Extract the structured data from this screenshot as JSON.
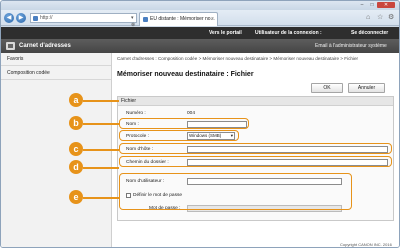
{
  "browser": {
    "window_controls": {
      "minimize": "–",
      "maximize": "□",
      "close": "✕"
    },
    "nav": {
      "back": "◀",
      "forward": "▶"
    },
    "url": "http://",
    "address_tools": "▾ ⊗ ⟳ ✕",
    "tab": {
      "title": "EU distante : Mémoriser no...",
      "close": "×"
    },
    "toolbar_icons": {
      "home": "⌂",
      "favorites": "☆",
      "settings": "⚙"
    }
  },
  "topbar": {
    "portal_link": "Vers le portail",
    "user_label": "Utilisateur de la connexion :",
    "user_name": "",
    "logout_link": "Se déconnecter"
  },
  "header": {
    "title": "Carnet d'adresses",
    "admin_mail": "Email à l'administrateur système"
  },
  "sidebar": {
    "items": [
      {
        "label": "Favoris"
      },
      {
        "label": "Composition codée"
      }
    ]
  },
  "main": {
    "breadcrumb": "Carnet d'adresses : Composition codée > Mémoriser nouveau destinataire > Mémoriser nouveau destinataire > Fichier",
    "title": "Mémoriser nouveau destinataire : Fichier",
    "ok_label": "OK",
    "cancel_label": "Annuler"
  },
  "form": {
    "section_title": "Fichier",
    "number_label": "Numéro :",
    "number_value": "004",
    "name_label": "Nom :",
    "name_value": "",
    "protocol_label": "Protocole :",
    "protocol_value": "Windows (SMB)",
    "host_label": "Nom d'hôte :",
    "host_value": "",
    "folder_label": "Chemin du dossier :",
    "folder_value": "",
    "username_label": "Nom d'utilisateur :",
    "username_value": "",
    "define_password_label": "Définir le mot de passe",
    "password_label": "Mot de passe :",
    "password_value": ""
  },
  "callouts": {
    "a": "a",
    "b": "b",
    "c": "c",
    "d": "d",
    "e": "e"
  },
  "accent_color": "#e7931a",
  "copyright": "Copyright CANON INC. 2016"
}
